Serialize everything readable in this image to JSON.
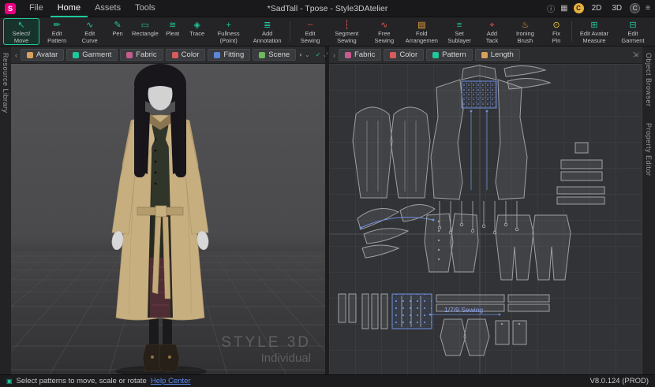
{
  "colors": {
    "accent": "#1fc79b",
    "sewing_red": "#e2574c",
    "warn_orange": "#e8a33d",
    "pin_yellow": "#e8c63d",
    "selection_blue": "#6f8fe0",
    "logo_pink": "#e6007e",
    "link_blue": "#5b8ded"
  },
  "icons": {
    "info": "ⓘ",
    "apps_grid": "▦",
    "menu": "≡",
    "shading": "◐",
    "check": "✓",
    "chevron_down": "⌄",
    "expand": "⇲",
    "collapse_left": "‹",
    "collapse_right": "›",
    "status": "▣"
  },
  "titlebar": {
    "logo_letter": "S",
    "file_label": "File",
    "menus": [
      {
        "label": "Home",
        "active": true
      },
      {
        "label": "Assets",
        "active": false
      },
      {
        "label": "Tools",
        "active": false
      }
    ],
    "title": "*SadTall - Tpose - Style3DAtelier",
    "view_2d": "2D",
    "view_3d": "3D",
    "coin_badge": "C",
    "user_badge": "C"
  },
  "toolbar": {
    "tools": [
      {
        "id": "select-move",
        "label": "Select/ Move",
        "glyph": "↖",
        "color": "#1fc79b",
        "active": true
      },
      {
        "id": "edit-pattern",
        "label": "Edit Pattern",
        "glyph": "✏",
        "color": "#1fc79b"
      },
      {
        "id": "edit-curve",
        "label": "Edit Curve",
        "glyph": "∿",
        "color": "#1fc79b"
      },
      {
        "id": "pen",
        "label": "Pen",
        "glyph": "✎",
        "color": "#1fc79b"
      },
      {
        "id": "rectangle",
        "label": "Rectangle",
        "glyph": "▭",
        "color": "#1fc79b"
      },
      {
        "id": "pleat",
        "label": "Pleat",
        "glyph": "≋",
        "color": "#1fc79b"
      },
      {
        "id": "trace",
        "label": "Trace",
        "glyph": "◈",
        "color": "#1fc79b"
      },
      {
        "id": "fullness-point",
        "label": "Fullness (Point)",
        "glyph": "+",
        "color": "#1fc79b"
      },
      {
        "id": "add-annotation",
        "label": "Add Annotation",
        "glyph": "≣",
        "color": "#1fc79b"
      },
      {
        "id": "edit-sewing",
        "label": "Edit Sewing",
        "glyph": "┄",
        "color": "#e2574c",
        "sep": true
      },
      {
        "id": "segment-sewing",
        "label": "Segment Sewing",
        "glyph": "┆",
        "color": "#e2574c"
      },
      {
        "id": "free-sewing",
        "label": "Free Sewing",
        "glyph": "∿",
        "color": "#e2574c"
      },
      {
        "id": "fold-arrangement",
        "label": "Fold Arrangemen",
        "glyph": "▤",
        "color": "#e8a33d"
      },
      {
        "id": "set-sublayer",
        "label": "Set Sublayer",
        "glyph": "≡",
        "color": "#1fc79b"
      },
      {
        "id": "add-tack",
        "label": "Add Tack",
        "glyph": "⌖",
        "color": "#e2574c"
      },
      {
        "id": "ironing-brush",
        "label": "Ironing Brush",
        "glyph": "♨",
        "color": "#e8a33d"
      },
      {
        "id": "fix-pin",
        "label": "Fix Pin",
        "glyph": "⊙",
        "color": "#e8c63d"
      },
      {
        "id": "edit-avatar-measure",
        "label": "Edit Avatar Measure",
        "glyph": "⊞",
        "color": "#1fc79b",
        "sep": true
      },
      {
        "id": "edit-garment-measure",
        "label": "Edit Garment Measure",
        "glyph": "⊟",
        "color": "#1fc79b"
      }
    ]
  },
  "viewport3d": {
    "tabs": [
      {
        "id": "avatar",
        "label": "Avatar",
        "color": "#d9a05b"
      },
      {
        "id": "garment",
        "label": "Garment",
        "color": "#1fc79b"
      },
      {
        "id": "fabric",
        "label": "Fabric",
        "color": "#c75b8e"
      },
      {
        "id": "color",
        "label": "Color",
        "color": "#d95b5b"
      },
      {
        "id": "fitting",
        "label": "Fitting",
        "color": "#5b86d9"
      },
      {
        "id": "scene",
        "label": "Scene",
        "color": "#6fb85b"
      }
    ],
    "watermark_line1": "STYLE 3D",
    "watermark_line2": "Individual"
  },
  "viewport2d": {
    "tabs": [
      {
        "id": "fabric-2d",
        "label": "Fabric",
        "color": "#c75b8e"
      },
      {
        "id": "color-2d",
        "label": "Color",
        "color": "#d95b5b"
      },
      {
        "id": "pattern-2d",
        "label": "Pattern",
        "color": "#1fc79b"
      },
      {
        "id": "length-2d",
        "label": "Length",
        "color": "#d9a05b"
      }
    ],
    "annotation": "1/7/9 Sewing"
  },
  "side_left": {
    "label": "Resource Library"
  },
  "side_right": {
    "object_browser": "Object Browser",
    "property_editor": "Property Editor"
  },
  "statusbar": {
    "prompt": "Select patterns to move, scale or rotate",
    "link": "Help Center",
    "version": "V8.0.124 (PROD)"
  }
}
